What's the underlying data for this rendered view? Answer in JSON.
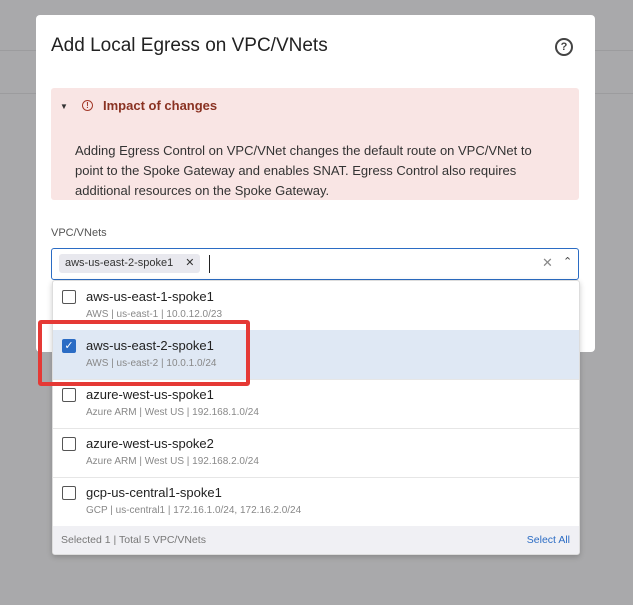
{
  "modal": {
    "title": "Add Local Egress on VPC/VNets",
    "help_icon": "question-circle-icon",
    "help_glyph": "?",
    "alert": {
      "title": "Impact of changes",
      "caret": "▼",
      "icon_glyph": "!",
      "body": "Adding Egress Control on VPC/VNet changes the default route on VPC/VNet to point to the Spoke Gateway and enables SNAT. Egress Control also requires additional resources on the Spoke Gateway.",
      "color": "#8a3222",
      "background": "#f9e5e4"
    },
    "field_label": "VPC/VNets",
    "selected_tag": "aws-us-east-2-spoke1",
    "tag_remove": "✕",
    "clear_glyph": "✕",
    "chevron_glyph": "⌃"
  },
  "dropdown": {
    "options": [
      {
        "name": "aws-us-east-1-spoke1",
        "desc": "AWS | us-east-1 | 10.0.12.0/23",
        "checked": false
      },
      {
        "name": "aws-us-east-2-spoke1",
        "desc": "AWS | us-east-2 | 10.0.1.0/24",
        "checked": true
      },
      {
        "name": "azure-west-us-spoke1",
        "desc": "Azure ARM | West US | 192.168.1.0/24",
        "checked": false
      },
      {
        "name": "azure-west-us-spoke2",
        "desc": "Azure ARM | West US | 192.168.2.0/24",
        "checked": false
      },
      {
        "name": "gcp-us-central1-spoke1",
        "desc": "GCP | us-central1 | 172.16.1.0/24, 172.16.2.0/24",
        "checked": false
      }
    ],
    "footer_count": "Selected 1 | Total 5 VPC/VNets",
    "select_all": "Select All",
    "check_glyph": "✓"
  },
  "colors": {
    "accent": "#2b6cc4",
    "highlight": "#e53935"
  }
}
